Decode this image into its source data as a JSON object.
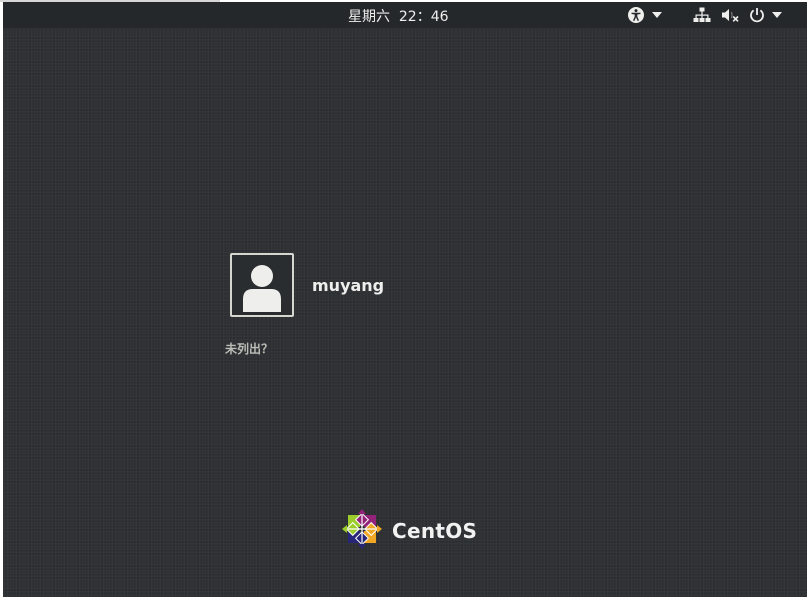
{
  "topbar": {
    "clock": "星期六  22：46",
    "icons": {
      "accessibility": "accessibility-icon",
      "accessibility_menu": "chevron-down-icon",
      "network": "network-wired-icon",
      "volume": "volume-muted-icon",
      "power": "power-icon",
      "system_menu": "chevron-down-icon"
    },
    "text_color": "#eeeeec",
    "background": "#25282b"
  },
  "login": {
    "users": [
      {
        "name": "muyang",
        "avatar_icon": "default-avatar-icon"
      }
    ],
    "not_listed_label": "未列出？"
  },
  "branding": {
    "logo_icon": "centos-logo-icon",
    "name": "CentOS"
  },
  "colors": {
    "background": "#2e3134",
    "text": "#eeeeec",
    "secondary_text": "#babdb6"
  }
}
